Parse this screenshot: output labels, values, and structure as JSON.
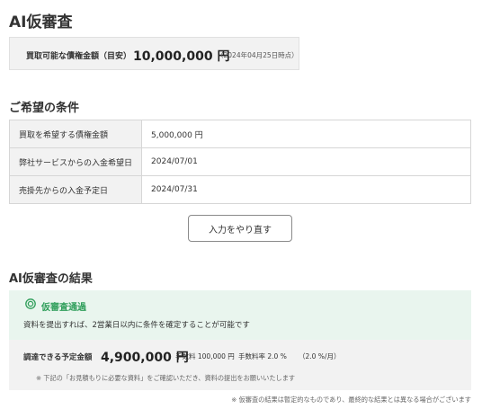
{
  "page": {
    "title": "AI仮審査"
  },
  "limit": {
    "label": "買取可能な債権金額（目安）",
    "value": "10,000,000 円",
    "note": "（2024年04月25日時点）"
  },
  "conditions": {
    "heading": "ご希望の条件",
    "rows": [
      {
        "label": "買取を希望する債権金額",
        "value": "5,000,000 円"
      },
      {
        "label": "弊社サービスからの入金希望日",
        "value": "2024/07/01"
      },
      {
        "label": "売掛先からの入金予定日",
        "value": "2024/07/31"
      }
    ],
    "redo_button": "入力をやり直す"
  },
  "result": {
    "heading": "AI仮審査の結果",
    "status_icon": "circle-check-icon",
    "status_title": "仮審査通過",
    "status_desc": "資料を提出すれば、2営業日以内に条件を確定することが可能です",
    "amount_label": "調達できる予定金額",
    "amount_value": "4,900,000 円",
    "fee": "手数料 100,000 円",
    "fee_rate": "手数料率 2.0 %",
    "annual_rate": "（2.0 %/月）",
    "note": "※ 下記の「お見積もりに必要な資料」をご確認いただき、資料の提出をお願いいたします",
    "footer_note": "※ 仮審査の結果は暫定的なものであり、最終的な結果とは異なる場合がございます"
  },
  "colors": {
    "accent_green": "#2f9e5a",
    "success_bg": "#e9f5ee",
    "panel_gray": "#f2f2f2"
  }
}
